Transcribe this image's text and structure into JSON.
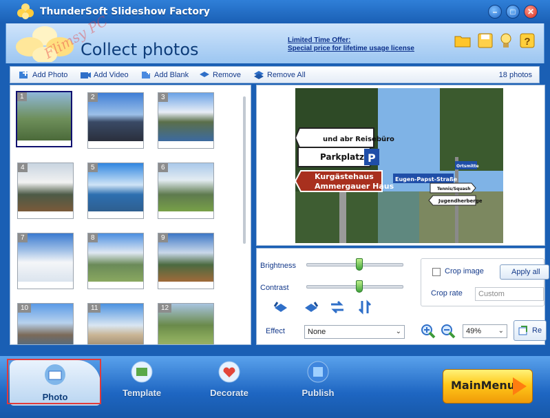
{
  "window": {
    "title": "ThunderSoft Slideshow Factory"
  },
  "header": {
    "page_title": "Collect photos",
    "offer_line1": "Limited Time Offer:",
    "offer_line2": "Special price for lifetime usage license",
    "watermark": "Flimsy PC",
    "icons": [
      "folder-icon",
      "save-icon",
      "lightbulb-icon",
      "help-icon"
    ]
  },
  "toolbar": {
    "add_photo": "Add Photo",
    "add_video": "Add Video",
    "add_blank": "Add Blank",
    "remove": "Remove",
    "remove_all": "Remove All",
    "count": "18 photos"
  },
  "thumbnails": [
    {
      "n": "1"
    },
    {
      "n": "2"
    },
    {
      "n": "3"
    },
    {
      "n": "4"
    },
    {
      "n": "5"
    },
    {
      "n": "6"
    },
    {
      "n": "7"
    },
    {
      "n": "8"
    },
    {
      "n": "9"
    },
    {
      "n": "10"
    },
    {
      "n": "11"
    },
    {
      "n": "12"
    }
  ],
  "preview": {
    "sign1": "und abr Reisebüro",
    "sign2": "Parkplatz",
    "sign2_p": "P",
    "sign3a": "Kurgästehaus",
    "sign3b": "Ammergauer Haus",
    "sign4": "Eugen-Papst-Straße",
    "sign5": "Ortsmitte",
    "sign6": "Tennis/Squash",
    "sign7": "Jugendherberge"
  },
  "controls": {
    "brightness_label": "Brightness",
    "contrast_label": "Contrast",
    "brightness": 0.55,
    "contrast": 0.55,
    "effect_label": "Effect",
    "effect_value": "None",
    "crop_image_label": "Crop image",
    "crop_checked": false,
    "apply_all": "Apply all",
    "crop_rate_label": "Crop rate",
    "crop_rate_value": "Custom",
    "zoom_value": "49%",
    "reset_label": "Re"
  },
  "nav": {
    "photo": "Photo",
    "template": "Template",
    "decorate": "Decorate",
    "publish": "Publish",
    "main_menu": "MainMenu"
  },
  "colors": {
    "accent": "#1a5fb4",
    "highlight": "#e23a3a",
    "mainmenu": "#ffc81a"
  }
}
